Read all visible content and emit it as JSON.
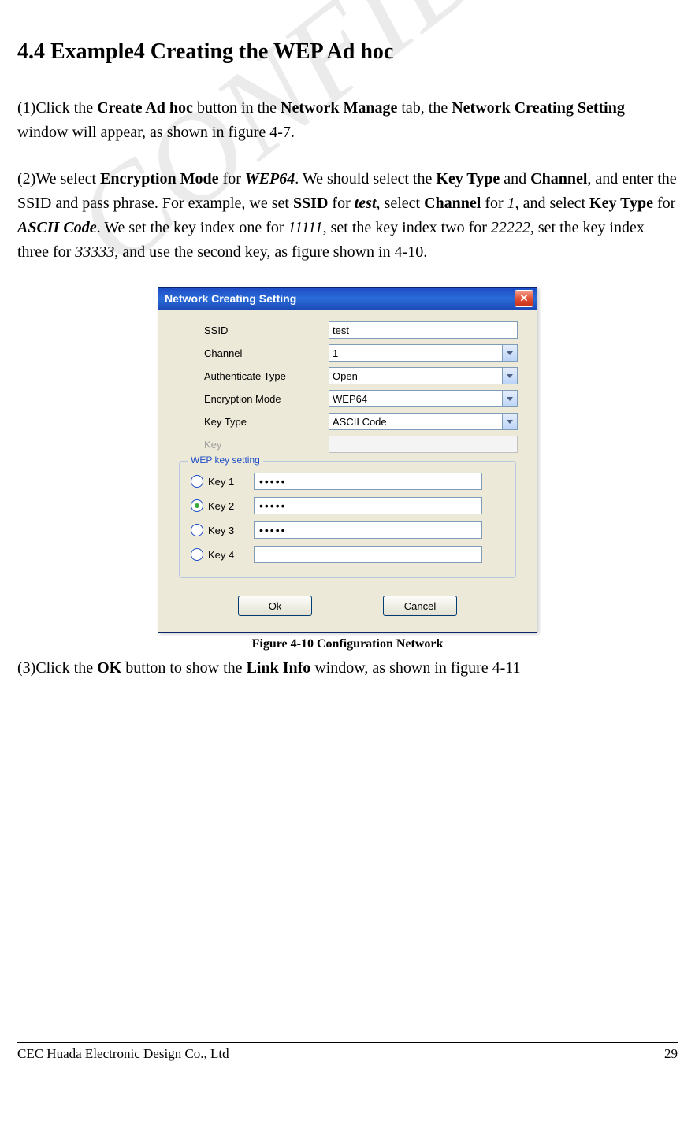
{
  "watermark": "CONFIDENTIAL",
  "heading": "4.4 Example4 Creating the WEP Ad hoc",
  "para1": {
    "prefix": "(1)Click the ",
    "b1": "Create Ad hoc",
    "t1": " button in the ",
    "b2": "Network Manage",
    "t2": " tab, the ",
    "b3": "Network Creating Setting",
    "t3": " window will appear, as shown in figure 4-7."
  },
  "para2": {
    "prefix": "(2)We select ",
    "b1": "Encryption Mode",
    "t1": " for ",
    "bi1": "WEP64",
    "t2": ". We should select the ",
    "b2": "Key Type",
    "t3": " and ",
    "b3": "Channel",
    "t4": ", and enter the SSID and pass phrase. For example, we set ",
    "b4": "SSID",
    "t5": " for ",
    "bi2": "test",
    "t6": ", select ",
    "b5": "Channel",
    "t7": " for ",
    "i1": "1",
    "t8": ", and select ",
    "b6": "Key Type",
    "t9": " for ",
    "bi3": "ASCII Code",
    "t10": ". We set the key index one for ",
    "i2": "11111",
    "t11": ", set the key index two for ",
    "i3": "22222",
    "t12": ", set the key index three for ",
    "i4": "33333",
    "t13": ", and use the second key, as figure shown in 4-10."
  },
  "dialog": {
    "title": "Network Creating Setting",
    "labels": {
      "ssid": "SSID",
      "channel": "Channel",
      "auth": "Authenticate Type",
      "enc": "Encryption Mode",
      "keytype": "Key Type",
      "key": "Key"
    },
    "values": {
      "ssid": "test",
      "channel": "1",
      "auth": "Open",
      "enc": "WEP64",
      "keytype": "ASCII Code",
      "key": ""
    },
    "wep": {
      "legend": "WEP key setting",
      "keys": [
        {
          "label": "Key 1",
          "value": "•••••",
          "selected": false
        },
        {
          "label": "Key 2",
          "value": "•••••",
          "selected": true
        },
        {
          "label": "Key 3",
          "value": "•••••",
          "selected": false
        },
        {
          "label": "Key 4",
          "value": "",
          "selected": false
        }
      ]
    },
    "buttons": {
      "ok": "Ok",
      "cancel": "Cancel"
    }
  },
  "figure_caption": "Figure 4-10 Configuration Network",
  "para3": {
    "prefix": "(3)Click the ",
    "b1": "OK",
    "t1": " button to show the ",
    "b2": "Link Info",
    "t2": " window, as shown in figure 4-11"
  },
  "footer": {
    "company": "CEC Huada Electronic Design Co., Ltd",
    "page": "29"
  }
}
